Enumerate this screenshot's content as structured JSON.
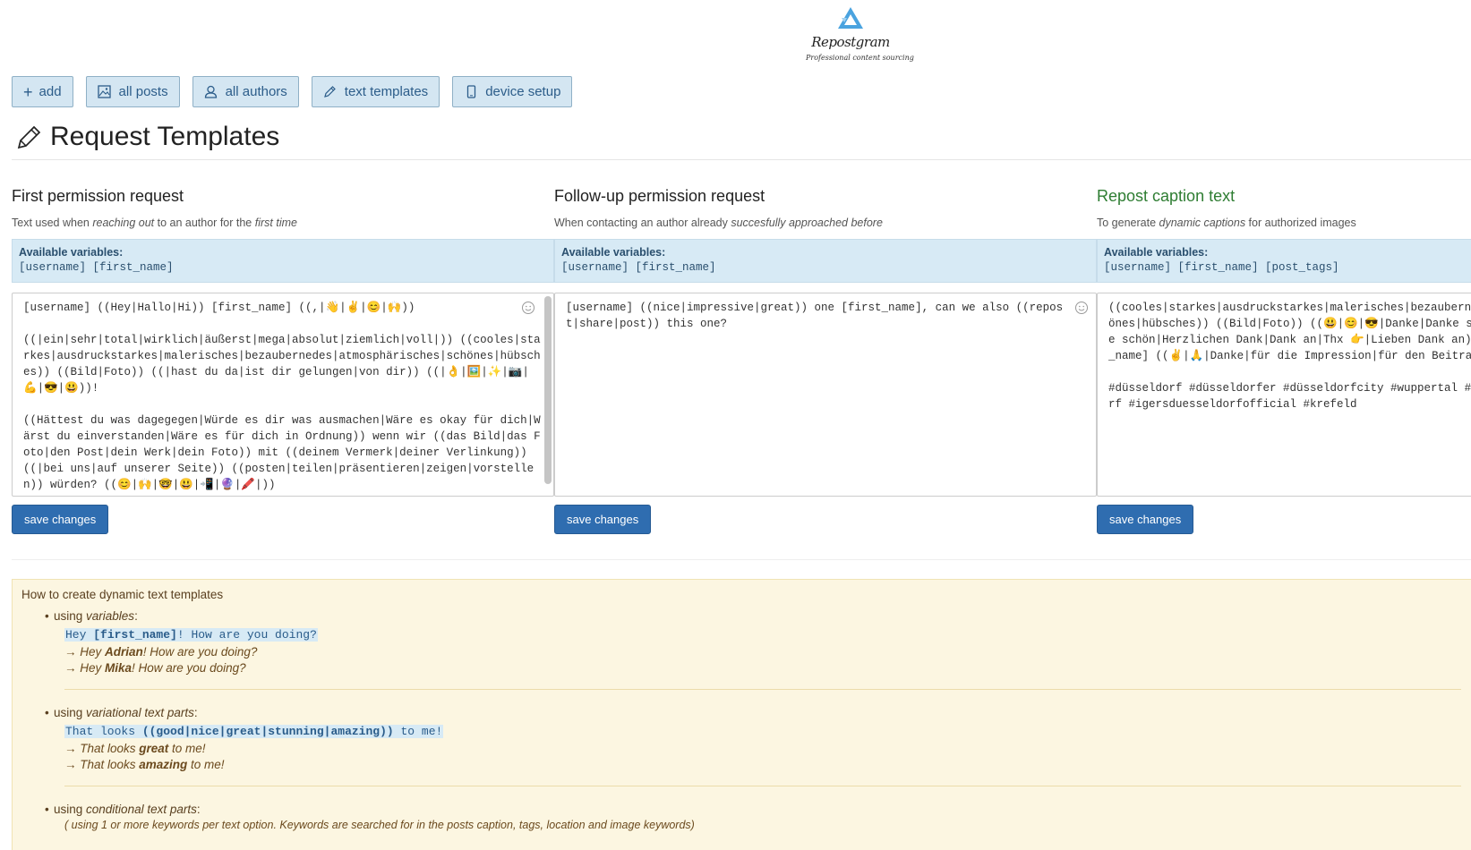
{
  "brand": {
    "name": "Repostgram",
    "tagline": "Professional content sourcing",
    "color": "#4aa3df"
  },
  "nav": [
    {
      "label": "add",
      "icon": "plus-icon"
    },
    {
      "label": "all posts",
      "icon": "image-icon"
    },
    {
      "label": "all authors",
      "icon": "user-icon"
    },
    {
      "label": "text templates",
      "icon": "pencil-icon"
    },
    {
      "label": "device setup",
      "icon": "phone-icon"
    }
  ],
  "page": {
    "title": "Request Templates"
  },
  "columns": [
    {
      "title": "First permission request",
      "desc_pre": "Text used when ",
      "desc_em1": "reaching out",
      "desc_mid": " to an author for the ",
      "desc_em2": "first time",
      "desc_post": "",
      "vars_label": "Available variables:",
      "vars": "[username] [first_name]",
      "text": "[username] ((Hey|Hallo|Hi)) [first_name] ((,|👋|✌️|😊|🙌))\n\n((|ein|sehr|total|wirklich|äußerst|mega|absolut|ziemlich|voll|)) ((cooles|starkes|ausdruckstarkes|malerisches|bezaubernedes|atmosphärisches|schönes|hübsches)) ((Bild|Foto)) ((|hast du da|ist dir gelungen|von dir)) ((|👌|🖼️|✨|📷|💪|😎|😃))!\n\n((Hättest du was dagegegen|Würde es dir was ausmachen|Wäre es okay für dich|Wärst du einverstanden|Wäre es für dich in Ordnung)) wenn wir ((das Bild|das Foto|den Post|dein Werk|dein Foto)) mit ((deinem Vermerk|deiner Verlinkung)) ((|bei uns|auf unserer Seite)) ((posten|teilen|präsentieren|zeigen|vorstellen)) würden? ((😊|🙌|🤓|😃|📲|🔮|🖍️|))",
      "save": "save changes"
    },
    {
      "title": "Follow-up permission request",
      "desc_pre": "When contacting an author already ",
      "desc_em1": "succesfully approached before",
      "desc_mid": "",
      "desc_em2": "",
      "desc_post": "",
      "vars_label": "Available variables:",
      "vars": "[username] [first_name]",
      "text": "[username] ((nice|impressive|great)) one [first_name], can we also ((repost|share|post)) this one?",
      "save": "save changes"
    },
    {
      "title": "Repost caption text",
      "desc_pre": "To generate ",
      "desc_em1": "dynamic captions",
      "desc_mid": " for authorized images",
      "desc_em2": "",
      "desc_post": "",
      "vars_label": "Available variables:",
      "vars": "[username] [first_name] [post_tags]",
      "text": "((cooles|starkes|ausdruckstarkes|malerisches|bezaubernedes|schönes|hübsches)) ((Bild|Foto)) ((😃|😊|😎|Danke|Danke sehr|Danke schön|Herzlichen Dank|Dank an|Thx 👉|Lieben Dank an)) [first_name] ((✌️|🙏|Danke|für die Impression|für den Beitrag|))!\n\n#düsseldorf #düsseldorfer #düsseldorfcity #wuppertal #dusseldorf #igersduesseldorfofficial #krefeld",
      "save": "save changes"
    }
  ],
  "help": {
    "title": "How to create dynamic text templates",
    "items": [
      {
        "pre": "using ",
        "em": "variables",
        "post": ":",
        "code_a": "Hey ",
        "code_b": "[first_name]",
        "code_c": "! How are you doing?",
        "r1_pre": "→ Hey ",
        "r1_b": "Adrian",
        "r1_post": "! How are you doing?",
        "r2_pre": "→ Hey ",
        "r2_b": "Mika",
        "r2_post": "! How are you doing?"
      },
      {
        "pre": "using ",
        "em": "variational text parts",
        "post": ":",
        "code_a": "That looks ",
        "code_b": "((good|nice|great|stunning|amazing))",
        "code_c": " to me!",
        "r1_pre": "→ That looks ",
        "r1_b": "great",
        "r1_post": " to me!",
        "r2_pre": "→ That looks ",
        "r2_b": "amazing",
        "r2_post": " to me!"
      },
      {
        "pre": "using ",
        "em": "conditional text parts",
        "post": ":",
        "note": "( using 1 or more keywords per text option. Keywords are searched for in the posts caption, tags, location and image keywords)"
      }
    ]
  }
}
